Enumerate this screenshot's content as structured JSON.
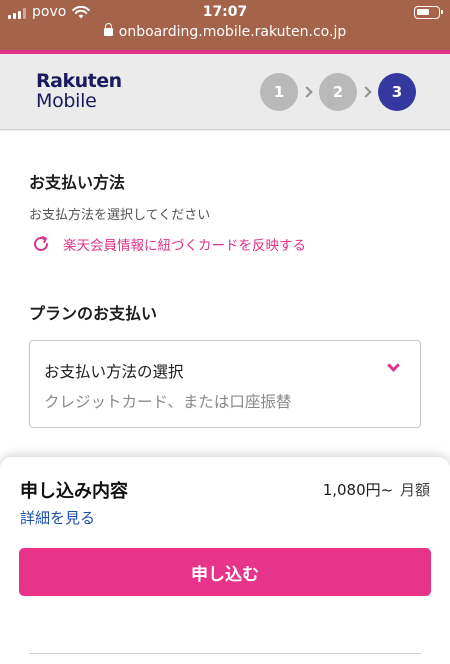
{
  "status_bar": {
    "carrier": "povo",
    "time": "17:07",
    "url": "onboarding.mobile.rakuten.co.jp"
  },
  "header": {
    "logo_line1": "Rakuten",
    "logo_line2": "Mobile",
    "steps": [
      "1",
      "2",
      "3"
    ],
    "active_step": "3"
  },
  "payment_method": {
    "title": "お支払い方法",
    "subtitle": "お支払方法を選択してください",
    "reflect_link": "楽天会員情報に紐づくカードを反映する"
  },
  "plan_payment": {
    "title": "プランのお支払い",
    "select_label": "お支払い方法の選択",
    "select_placeholder": "クレジットカード、または口座振替"
  },
  "summary": {
    "title": "申し込み内容",
    "price": "1,080円~",
    "price_unit": "月額",
    "details_link": "詳細を見る",
    "apply_button": "申し込む"
  },
  "colors": {
    "status_bar_bg": "#a5644a",
    "accent_pink": "#e0338a",
    "active_step": "#35399f",
    "link_blue": "#1c4fa8"
  }
}
